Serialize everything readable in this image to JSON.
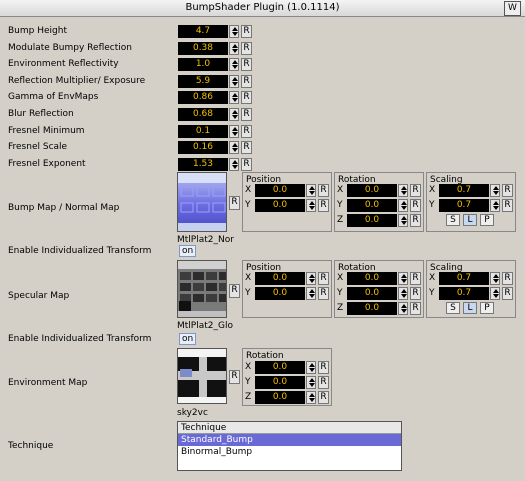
{
  "window": {
    "title": "BumpShader Plugin (1.0.1114)",
    "corner_icon": "W"
  },
  "params": [
    {
      "label": "Bump Height",
      "value": "4.7"
    },
    {
      "label": "Modulate Bumpy Reflection",
      "value": "0.38"
    },
    {
      "label": "Environment Reflectivity",
      "value": "1.0"
    },
    {
      "label": "Reflection Multiplier/ Exposure",
      "value": "5.9"
    },
    {
      "label": "Gamma of EnvMaps",
      "value": "0.86"
    },
    {
      "label": "Blur Reflection",
      "value": "0.68"
    },
    {
      "label": "Fresnel Minimum",
      "value": "0.1"
    },
    {
      "label": "Fresnel Scale",
      "value": "0.16"
    },
    {
      "label": "Fresnel Exponent",
      "value": "1.53"
    }
  ],
  "reset_label": "R",
  "bump_map": {
    "label": "Bump Map / Normal Map",
    "texture_name": "MtlPlat2_Nor",
    "position": {
      "title": "Position",
      "x": "0.0",
      "y": "0.0"
    },
    "rotation": {
      "title": "Rotation",
      "x": "0.0",
      "y": "0.0",
      "z": "0.0"
    },
    "scaling": {
      "title": "Scaling",
      "x": "0.7",
      "y": "0.7"
    }
  },
  "bump_transform": {
    "label": "Enable Individualized Transform",
    "value": "on"
  },
  "specular_map": {
    "label": "Specular Map",
    "texture_name": "MtlPlat2_Glo",
    "position": {
      "title": "Position",
      "x": "0.0",
      "y": "0.0"
    },
    "rotation": {
      "title": "Rotation",
      "x": "0.0",
      "y": "0.0",
      "z": "0.0"
    },
    "scaling": {
      "title": "Scaling",
      "x": "0.7",
      "y": "0.7"
    }
  },
  "specular_transform": {
    "label": "Enable Individualized Transform",
    "value": "on"
  },
  "environment_map": {
    "label": "Environment Map",
    "texture_name": "sky2vc",
    "rotation": {
      "title": "Rotation",
      "x": "0.0",
      "y": "0.0",
      "z": "0.0"
    }
  },
  "axes": {
    "x": "X",
    "y": "Y",
    "z": "Z"
  },
  "scale_modes": [
    "S",
    "L",
    "P"
  ],
  "technique": {
    "label": "Technique",
    "header": "Technique",
    "options": [
      "Standard_Bump",
      "Binormal_Bump"
    ],
    "selected": "Standard_Bump"
  }
}
